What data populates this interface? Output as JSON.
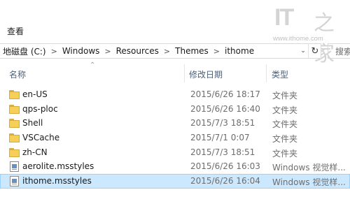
{
  "ribbon": {
    "tab_view": "查看"
  },
  "watermark": {
    "logo_left": "IT",
    "logo_right": "之家",
    "url": "www.ithome.com"
  },
  "address_bar": {
    "crumbs": [
      "地磁盘 (C:)",
      "Windows",
      "Resources",
      "Themes",
      "ithome"
    ],
    "search_placeholder": "搜索"
  },
  "columns": {
    "name": "名称",
    "date": "修改日期",
    "type": "类型"
  },
  "files": [
    {
      "name": "en-US",
      "date": "2015/6/26 18:17",
      "type": "文件夹",
      "icon": "folder-icon",
      "selected": false
    },
    {
      "name": "qps-ploc",
      "date": "2015/6/26 16:40",
      "type": "文件夹",
      "icon": "folder-icon",
      "selected": false
    },
    {
      "name": "Shell",
      "date": "2015/7/3 18:51",
      "type": "文件夹",
      "icon": "folder-icon",
      "selected": false
    },
    {
      "name": "VSCache",
      "date": "2015/7/1 0:07",
      "type": "文件夹",
      "icon": "folder-icon",
      "selected": false
    },
    {
      "name": "zh-CN",
      "date": "2015/7/3 18:51",
      "type": "文件夹",
      "icon": "folder-icon",
      "selected": false
    },
    {
      "name": "aerolite.msstyles",
      "date": "2015/6/26 16:03",
      "type": "Windows 视觉样...",
      "icon": "msstyles-file-icon",
      "selected": false
    },
    {
      "name": "ithome.msstyles",
      "date": "2015/6/26 16:04",
      "type": "Windows 视觉样...",
      "icon": "msstyles-file-icon",
      "selected": true
    }
  ]
}
